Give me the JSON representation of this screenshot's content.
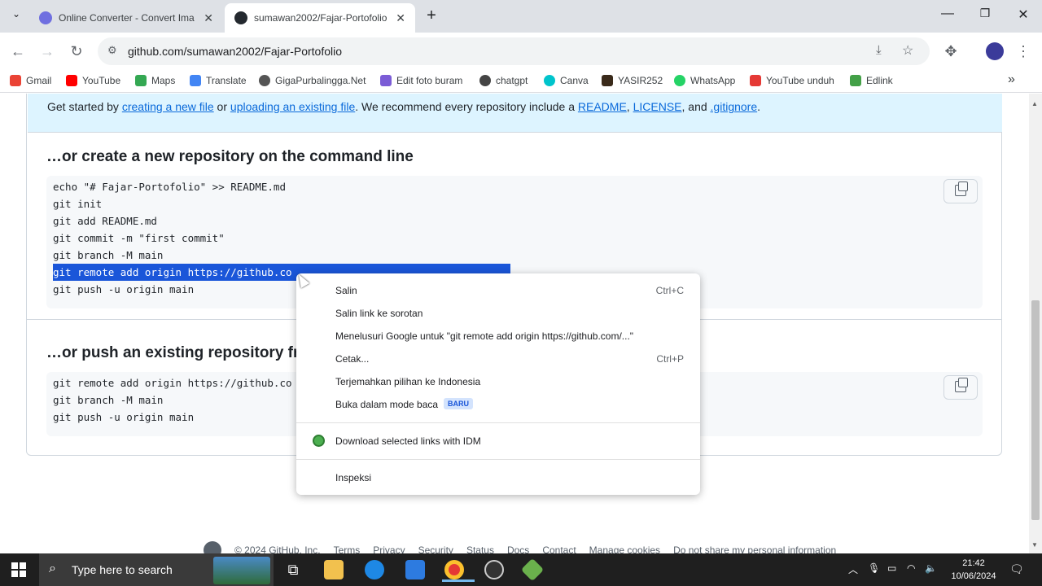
{
  "browser": {
    "tabs": [
      {
        "label": "Online Converter - Convert Ima",
        "active": false
      },
      {
        "label": "sumawan2002/Fajar-Portofolio",
        "active": true
      }
    ],
    "new_tab": "+",
    "url": "github.com/sumawan2002/Fajar-Portofolio",
    "bookmarks": [
      "Gmail",
      "YouTube",
      "Maps",
      "Translate",
      "GigaPurbalingga.Net",
      "Edit foto buram",
      "chatgpt",
      "Canva",
      "YASIR252",
      "WhatsApp",
      "YouTube unduh",
      "Edlink"
    ],
    "bookmark_overflow": "»"
  },
  "page": {
    "get_started": {
      "prefix": "Get started by ",
      "link1": "creating a new file",
      "mid1": " or ",
      "link2": "uploading an existing file",
      "mid2": ". We recommend every repository include a ",
      "link3": "README",
      "sep1": ", ",
      "link4": "LICENSE",
      "sep2": ", and ",
      "link5": ".gitignore",
      "suffix": "."
    },
    "section1_title": "…or create a new repository on the command line",
    "section1_code": [
      "echo \"# Fajar-Portofolio\" >> README.md",
      "git init",
      "git add README.md",
      "git commit -m \"first commit\"",
      "git branch -M main",
      "git remote add origin https://github.co",
      "git push -u origin main"
    ],
    "section2_title": "…or push an existing repository fr",
    "section2_code": [
      "git remote add origin https://github.co",
      "git branch -M main",
      "git push -u origin main"
    ],
    "footer": [
      "© 2024 GitHub, Inc.",
      "Terms",
      "Privacy",
      "Security",
      "Status",
      "Docs",
      "Contact",
      "Manage cookies",
      "Do not share my personal information"
    ]
  },
  "context_menu": {
    "items": [
      {
        "label": "Salin",
        "shortcut": "Ctrl+C"
      },
      {
        "label": "Salin link ke sorotan",
        "shortcut": ""
      },
      {
        "label": "Menelusuri Google untuk \"git remote add origin https://github.com/...\"",
        "shortcut": ""
      },
      {
        "label": "Cetak...",
        "shortcut": "Ctrl+P"
      },
      {
        "label": "Terjemahkan pilihan ke Indonesia",
        "shortcut": ""
      },
      {
        "label": "Buka dalam mode baca",
        "shortcut": "",
        "badge": "BARU"
      }
    ],
    "idm_item": "Download selected links with IDM",
    "inspect_item": "Inspeksi"
  },
  "taskbar": {
    "search_placeholder": "Type here to search",
    "time": "21:42",
    "date": "10/06/2024"
  },
  "colors": {
    "selection": "#1a56d9",
    "github_link": "#0969da",
    "banner_bg": "#ddf4ff"
  }
}
